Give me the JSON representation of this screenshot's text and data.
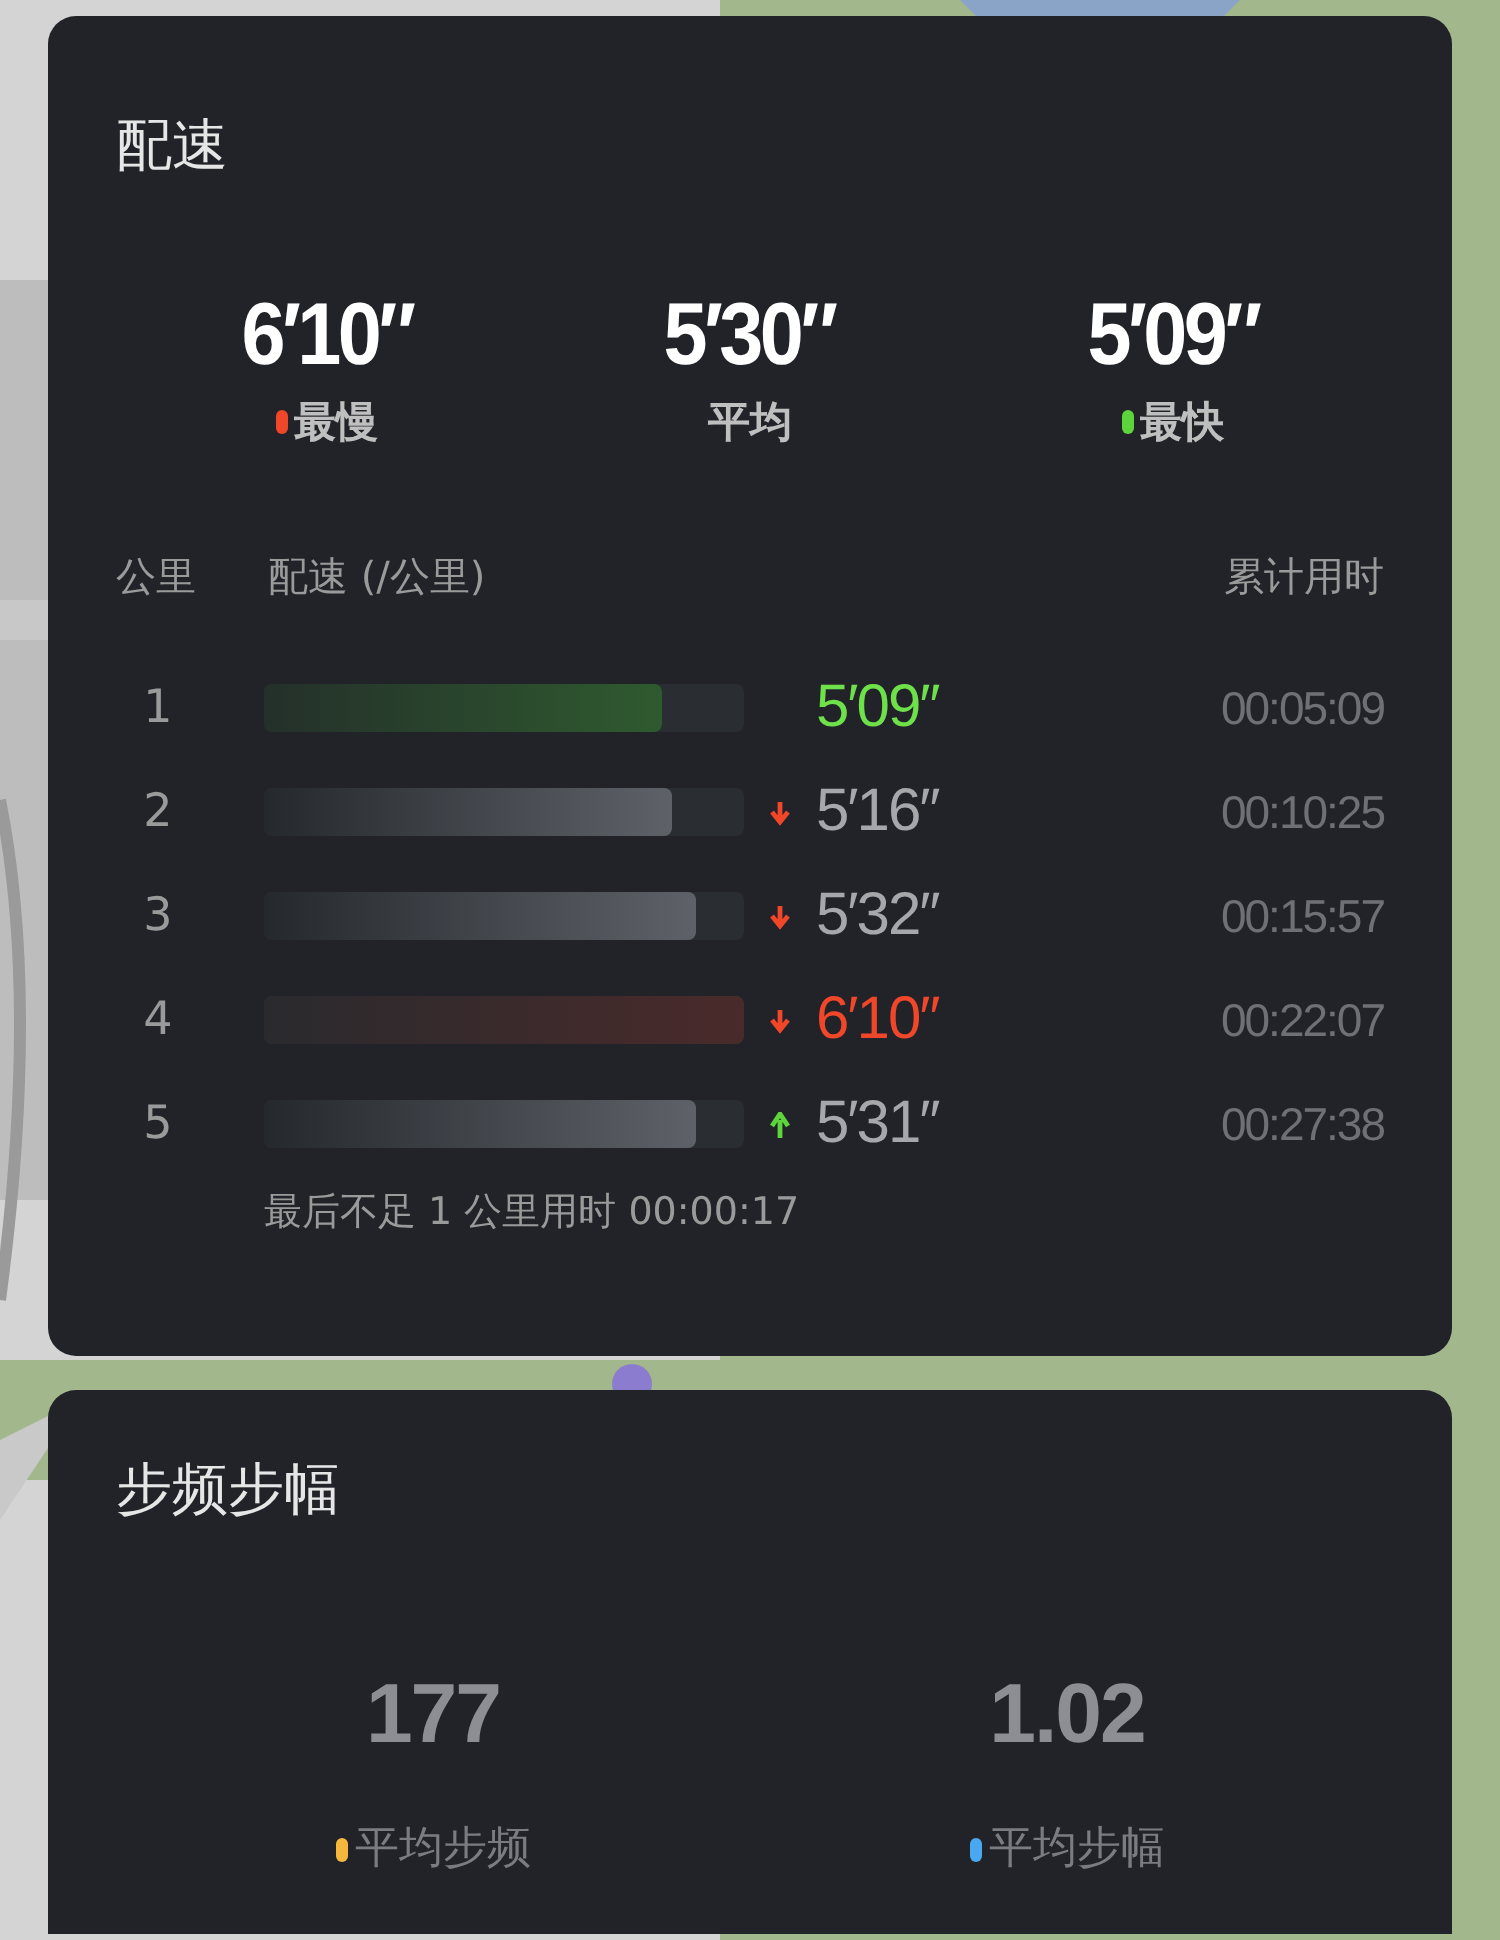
{
  "pace": {
    "title": "配速",
    "summary": [
      {
        "value": "6′10″",
        "label": "最慢",
        "color": "#f0462a"
      },
      {
        "value": "5′30″",
        "label": "平均"
      },
      {
        "value": "5′09″",
        "label": "最快",
        "color": "#5ed43c"
      }
    ],
    "columns": [
      "公里",
      "配速 (/公里)",
      "累计用时"
    ],
    "splits": [
      {
        "km": "1",
        "kind": "fastest",
        "level": 0.83,
        "pace": "5′09″",
        "cumulative": "00:05:09"
      },
      {
        "km": "2",
        "kind": "normal",
        "slower": true,
        "level": 0.85,
        "pace": "5′16″",
        "cumulative": "00:10:25"
      },
      {
        "km": "3",
        "kind": "normal",
        "slower": true,
        "level": 0.9,
        "pace": "5′32″",
        "cumulative": "00:15:57"
      },
      {
        "km": "4",
        "kind": "slowest",
        "slower": true,
        "level": 1.0,
        "pace": "6′10″",
        "cumulative": "00:22:07"
      },
      {
        "km": "5",
        "kind": "normal",
        "slower": false,
        "level": 0.9,
        "pace": "5′31″",
        "cumulative": "00:27:38"
      }
    ],
    "footnote": "最后不足 1 公里用时 00:00:17"
  },
  "cadence": {
    "title": "步频步幅",
    "stats": [
      {
        "value": "177",
        "label": "平均步频",
        "color": "#f5b83d"
      },
      {
        "value": "1.02",
        "label": "平均步幅",
        "color": "#4aa8f0"
      }
    ]
  }
}
